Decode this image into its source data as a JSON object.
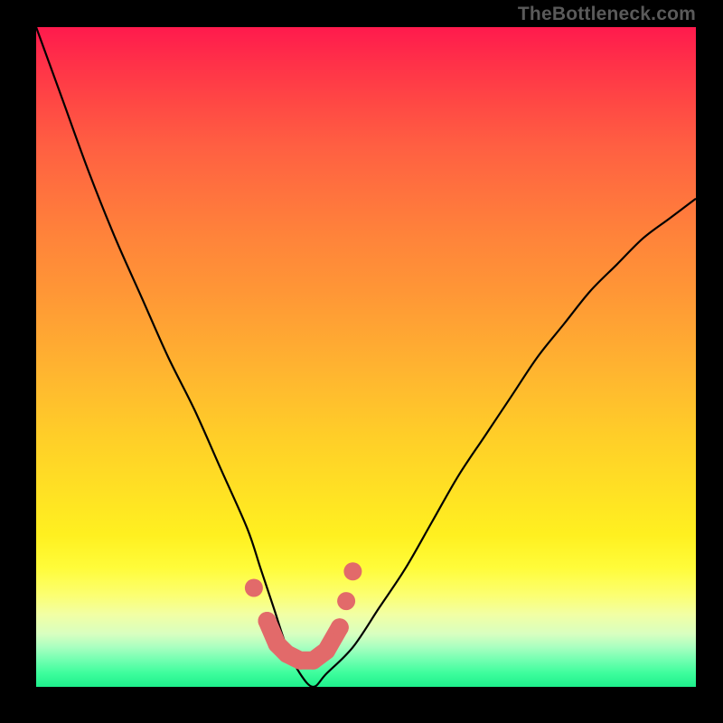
{
  "watermark": "TheBottleneck.com",
  "chart_data": {
    "type": "line",
    "title": "",
    "xlabel": "",
    "ylabel": "",
    "xlim": [
      0,
      100
    ],
    "ylim": [
      0,
      100
    ],
    "grid": false,
    "legend": false,
    "series": [
      {
        "name": "bottleneck-curve",
        "x": [
          0,
          4,
          8,
          12,
          16,
          20,
          24,
          28,
          32,
          34,
          36,
          38,
          40,
          42,
          44,
          48,
          52,
          56,
          60,
          64,
          68,
          72,
          76,
          80,
          84,
          88,
          92,
          96,
          100
        ],
        "y": [
          100,
          89,
          78,
          68,
          59,
          50,
          42,
          33,
          24,
          18,
          12,
          6,
          2,
          0,
          2,
          6,
          12,
          18,
          25,
          32,
          38,
          44,
          50,
          55,
          60,
          64,
          68,
          71,
          74
        ]
      }
    ],
    "markers": {
      "name": "optimal-range-dots",
      "color": "#e26a6a",
      "points": [
        {
          "x": 33.0,
          "y": 15.0
        },
        {
          "x": 35.0,
          "y": 10.0
        },
        {
          "x": 36.5,
          "y": 6.5
        },
        {
          "x": 38.0,
          "y": 5.0
        },
        {
          "x": 40.0,
          "y": 4.0
        },
        {
          "x": 42.0,
          "y": 4.0
        },
        {
          "x": 44.0,
          "y": 5.5
        },
        {
          "x": 46.0,
          "y": 9.0
        },
        {
          "x": 47.0,
          "y": 13.0
        },
        {
          "x": 48.0,
          "y": 17.5
        }
      ]
    },
    "background_gradient": {
      "top": "#ff1a4d",
      "mid": "#ffe024",
      "bottom": "#1ef08c"
    }
  }
}
